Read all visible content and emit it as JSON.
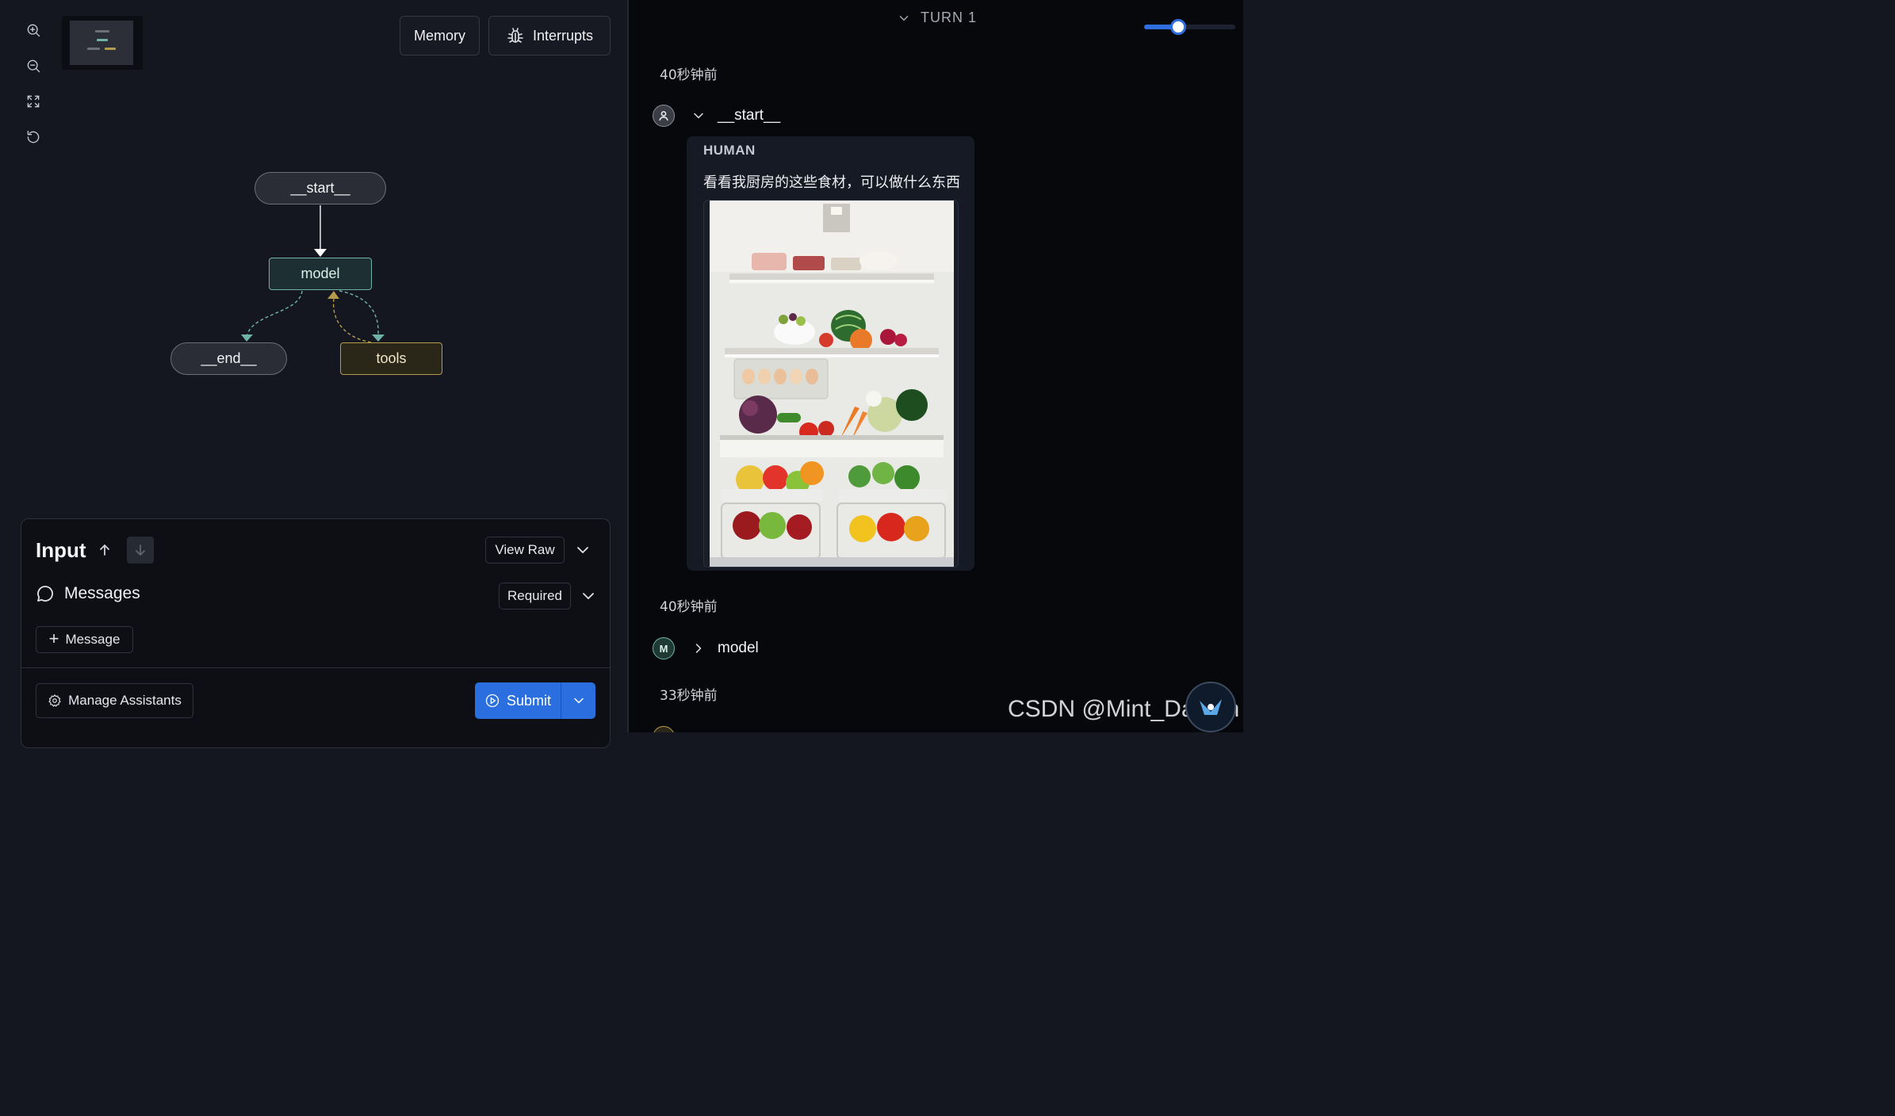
{
  "toolbar": {
    "zoom_in_icon": "zoom-in-icon",
    "zoom_out_icon": "zoom-out-icon",
    "fit_view_icon": "fit-view-icon",
    "reset_icon": "reset-icon",
    "memory_label": "Memory",
    "interrupts_label": "Interrupts",
    "interrupts_icon": "bug-icon"
  },
  "graph": {
    "nodes": {
      "start": "__start__",
      "model": "model",
      "end": "__end__",
      "tools": "tools"
    }
  },
  "input": {
    "title": "Input",
    "view_raw_label": "View Raw",
    "messages_label": "Messages",
    "required_label": "Required",
    "add_message_label": "Message",
    "manage_assistants_label": "Manage Assistants",
    "submit_label": "Submit"
  },
  "thread": {
    "turn_label": "TURN 1",
    "turn_slider_value": 0.37,
    "steps": [
      {
        "timestamp": "40秒钟前",
        "node": "__start__",
        "avatar": "person-icon"
      },
      {
        "timestamp": "40秒钟前",
        "node": "model",
        "avatar_letter": "M"
      },
      {
        "timestamp": "33秒钟前"
      }
    ],
    "human_message": {
      "role": "HUMAN",
      "text": "看看我厨房的这些食材，可以做什么东西",
      "image": "open refrigerator with fruits and vegetables"
    }
  },
  "watermark": "CSDN @Mint_Datazh",
  "colors": {
    "model_node": "#6fb3a8",
    "tools_node": "#b49a4c",
    "accent": "#2a6ee0"
  }
}
